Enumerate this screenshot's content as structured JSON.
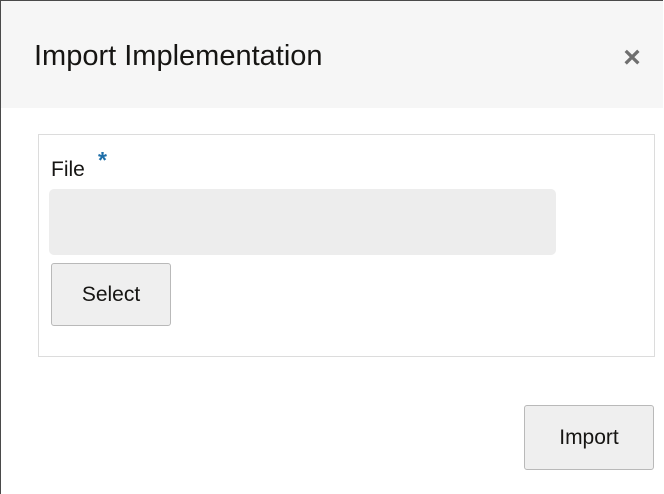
{
  "dialog": {
    "title": "Import Implementation",
    "close_label": "×"
  },
  "form": {
    "file_label": "File",
    "required_marker": "*",
    "file_value": "",
    "select_label": "Select"
  },
  "footer": {
    "import_label": "Import"
  },
  "colors": {
    "header_bg": "#f6f6f6",
    "required_marker": "#1d6ea8",
    "input_bg": "#ededed",
    "button_bg": "#efefef"
  }
}
